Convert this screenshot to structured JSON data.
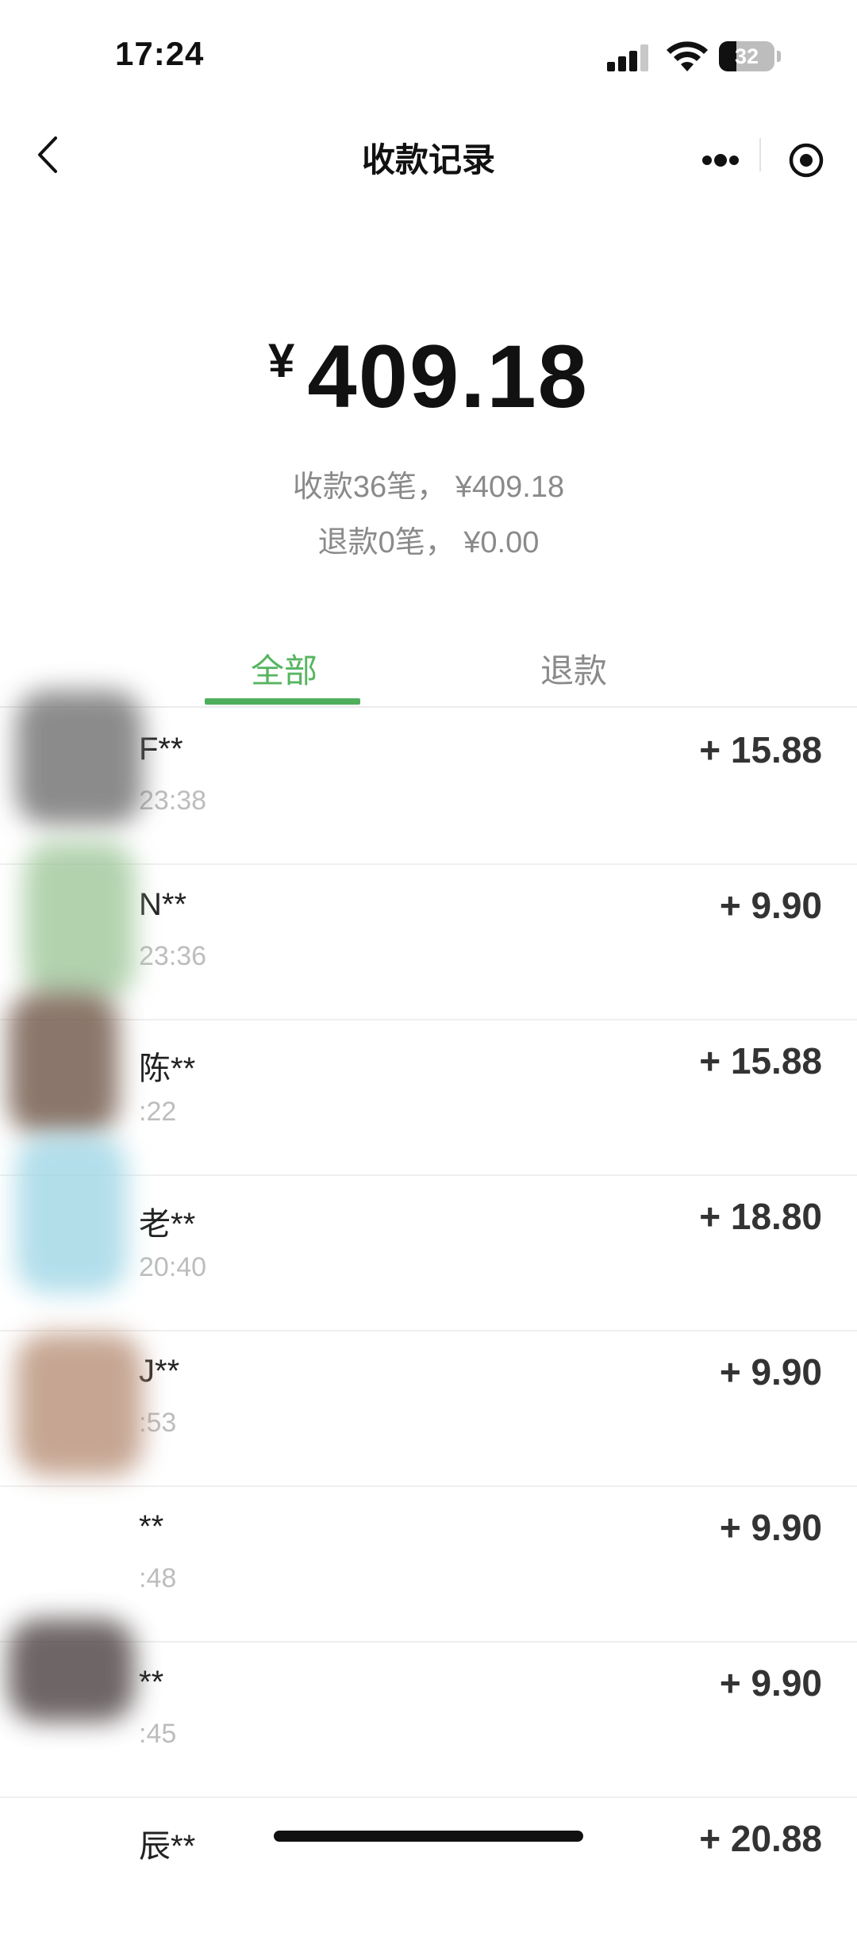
{
  "status_bar": {
    "time": "17:24",
    "battery": "32",
    "battery_level": 0.32
  },
  "nav": {
    "title": "收款记录"
  },
  "summary": {
    "total_amount": "409.18",
    "currency_symbol": "¥",
    "received_line": "收款36笔， ¥409.18",
    "refund_line": "退款0笔， ¥0.00"
  },
  "tabs": [
    {
      "label": "全部",
      "active": true
    },
    {
      "label": "退款",
      "active": false
    }
  ],
  "records": [
    {
      "name": "F**",
      "time": "23:38",
      "amount": "+ 15.88"
    },
    {
      "name": "N**",
      "time": "23:36",
      "amount": "+ 9.90"
    },
    {
      "name": "陈**",
      "time": ":22",
      "amount": "+ 15.88"
    },
    {
      "name": "老**",
      "time": "20:40",
      "amount": "+ 18.80"
    },
    {
      "name": "J**",
      "time": ":53",
      "amount": "+ 9.90"
    },
    {
      "name": "**",
      "time": ":48",
      "amount": "+ 9.90"
    },
    {
      "name": "**",
      "time": ":45",
      "amount": "+ 9.90"
    },
    {
      "name": "辰**",
      "time": "",
      "amount": "+ 20.88"
    }
  ],
  "colors": {
    "accent": "#57b560",
    "tab_indicator": "#4fae5b",
    "text_primary": "#111111",
    "text_secondary": "#8a8a8a",
    "time_text": "#bdbdbd"
  },
  "icons": {
    "back": "chevron-left-icon",
    "more": "more-dots-icon",
    "close": "target-circle-icon",
    "signal": "cellular-signal-icon",
    "wifi": "wifi-icon",
    "battery": "battery-icon"
  }
}
